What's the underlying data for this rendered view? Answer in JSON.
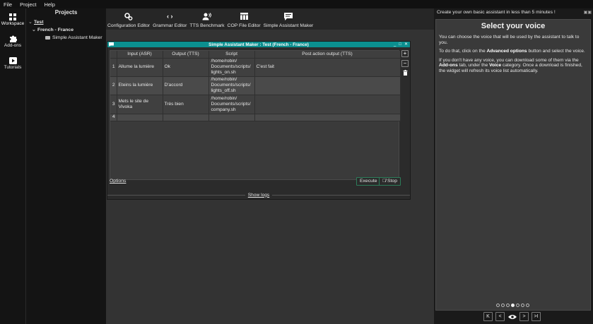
{
  "menubar": {
    "items": [
      "File",
      "Project",
      "Help"
    ]
  },
  "rail": {
    "items": [
      {
        "label": "Workspace",
        "icon": "grid-icon"
      },
      {
        "label": "Add-ons",
        "icon": "puzzle-icon"
      },
      {
        "label": "Tutorials",
        "icon": "play-icon"
      }
    ]
  },
  "projects": {
    "title": "Projects",
    "root": "Test",
    "language": "French - France",
    "item": "Simple Assistant Maker"
  },
  "toolbar": {
    "items": [
      {
        "label": "Configuration Editor",
        "icon": "gears-icon"
      },
      {
        "label": "Grammar Editor",
        "icon": "code-icon"
      },
      {
        "label": "TTS Benchmark",
        "icon": "speaker-person-icon"
      },
      {
        "label": "COP File Editor",
        "icon": "table-icon"
      },
      {
        "label": "Simple Assistant Maker",
        "icon": "chat-icon"
      }
    ]
  },
  "dialog": {
    "title": "Simple Assistant Maker : Test (French - France)",
    "controls": [
      "_",
      "□",
      "✕"
    ],
    "columns": [
      "Input (ASR)",
      "Output (TTS)",
      "Script",
      "Post action output (TTS)"
    ],
    "rows": [
      {
        "num": "1",
        "input": "Allume la lumière",
        "output": "Ok",
        "script": "/home/robin/ Documents/scripts/ lights_on.sh",
        "post": "C'est fait"
      },
      {
        "num": "2",
        "input": "Eteins la lumière",
        "output": "D'accord",
        "script": "/home/robin/ Documents/scripts/ lights_off.sh",
        "post": ""
      },
      {
        "num": "3",
        "input": "Mets le site de Vivoka",
        "output": "Très bien",
        "script": "/home/robin/ Documents/scripts/ company.sh",
        "post": ""
      },
      {
        "num": "4",
        "input": "",
        "output": "",
        "script": "",
        "post": ""
      }
    ],
    "side_buttons": {
      "add": "+",
      "remove": "−"
    },
    "options_label": "Options",
    "execute_label": "Execute",
    "stop_label": "Stop",
    "show_logs_label": "Show logs"
  },
  "right_panel": {
    "header": "Create your own basic assistant in less than 5 minutes !",
    "tip_title": "Select your voice",
    "p1": "You can choose the voice that will be used by the assistant to talk to you.",
    "p2_pre": "To do that, click on the ",
    "p2_bold": "Advanced options",
    "p2_post": " button and select the voice.",
    "p3_pre": "If you don't have any voice, you can download some of them via the ",
    "p3_bold1": "Add-ons",
    "p3_mid": " tab, under the ",
    "p3_bold2": "Voice",
    "p3_post": " category. Once a download is finished, the widget will refresh its voice list automatically.",
    "pagination": {
      "total": 7,
      "current": 4
    },
    "nav": {
      "first": "K",
      "prev": "<",
      "next": ">",
      "last": ">I"
    }
  }
}
